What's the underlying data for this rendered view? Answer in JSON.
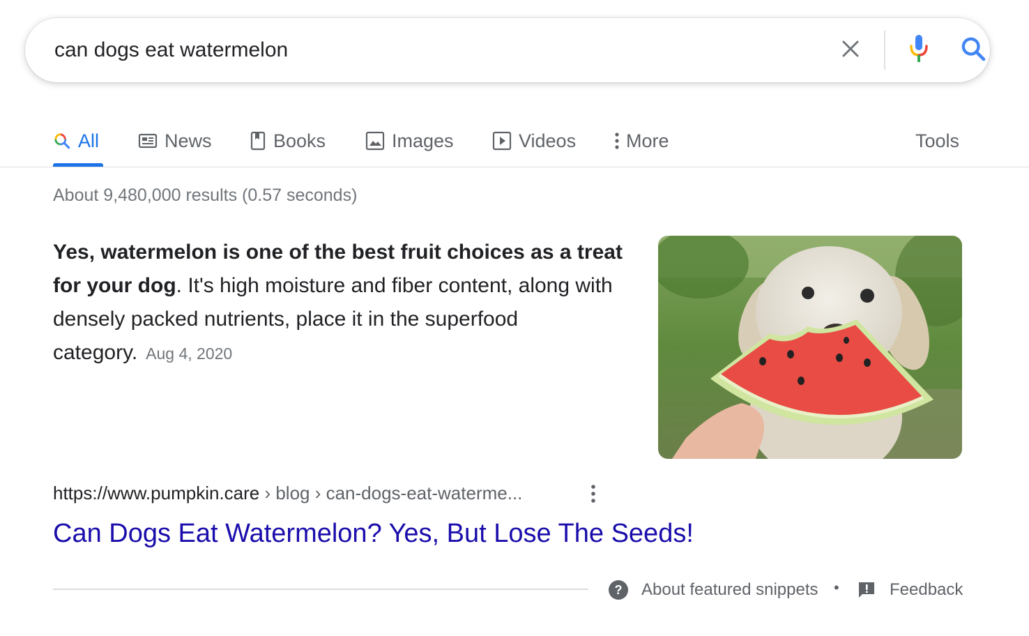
{
  "search": {
    "query": "can dogs eat watermelon",
    "clear_icon": "close-icon",
    "voice_icon": "microphone-icon",
    "search_icon": "search-icon"
  },
  "tabs": [
    {
      "label": "All",
      "icon": "search-icon",
      "active": true
    },
    {
      "label": "News",
      "icon": "news-icon",
      "active": false
    },
    {
      "label": "Books",
      "icon": "book-icon",
      "active": false
    },
    {
      "label": "Images",
      "icon": "image-icon",
      "active": false
    },
    {
      "label": "Videos",
      "icon": "play-icon",
      "active": false
    },
    {
      "label": "More",
      "icon": "more-vert-icon",
      "active": false
    }
  ],
  "tools_label": "Tools",
  "result_stats": "About 9,480,000 results (0.57 seconds)",
  "featured_snippet": {
    "bold_text": "Yes, watermelon is one of the best fruit choices as a treat for your dog",
    "text": ". It's high moisture and fiber content, along with densely packed nutrients, place it in the superfood category.",
    "date": "Aug 4, 2020",
    "image_alt": "dog eating watermelon slice"
  },
  "source": {
    "url": "https://www.pumpkin.care",
    "breadcrumbs": " › blog › can-dogs-eat-waterme...",
    "title": "Can Dogs Eat Watermelon? Yes, But Lose The Seeds!"
  },
  "footer": {
    "about_label": "About featured snippets",
    "separator": "•",
    "feedback_label": "Feedback"
  },
  "colors": {
    "accent": "#1a73e8",
    "link": "#1a0dab",
    "muted": "#70757a"
  }
}
